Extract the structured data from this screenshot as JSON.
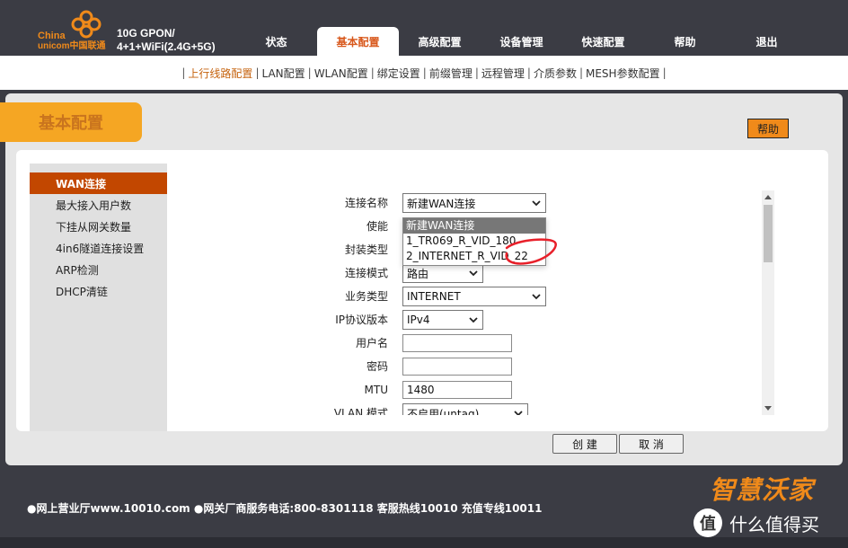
{
  "header": {
    "brand_en1": "China",
    "brand_en2": "unicom中国联通",
    "model_line1": "10G GPON/",
    "model_line2": "4+1+WiFi(2.4G+5G)",
    "nav": [
      "状态",
      "基本配置",
      "高级配置",
      "设备管理",
      "快速配置",
      "帮助",
      "退出"
    ],
    "active_nav": "基本配置"
  },
  "subnav": {
    "items": [
      "上行线路配置",
      "LAN配置",
      "WLAN配置",
      "绑定设置",
      "前缀管理",
      "远程管理",
      "介质参数",
      "MESH参数配置"
    ],
    "active": "上行线路配置"
  },
  "section": {
    "title": "基本配置",
    "help_label": "帮助"
  },
  "leftmenu": {
    "items": [
      "WAN连接",
      "最大接入用户数",
      "下挂从网关数量",
      "4in6隧道连接设置",
      "ARP检测",
      "DHCP清链"
    ],
    "active": "WAN连接"
  },
  "form": {
    "connection_name": {
      "label": "连接名称",
      "value": "新建WAN连接"
    },
    "enable": {
      "label": "使能"
    },
    "encapsulation": {
      "label": "封装类型"
    },
    "connection_mode": {
      "label": "连接模式",
      "value": "路由"
    },
    "service_type": {
      "label": "业务类型",
      "value": "INTERNET"
    },
    "ip_version": {
      "label": "IP协议版本",
      "value": "IPv4"
    },
    "username": {
      "label": "用户名",
      "value": ""
    },
    "password": {
      "label": "密码",
      "value": ""
    },
    "mtu": {
      "label": "MTU",
      "value": "1480"
    },
    "vlan_mode": {
      "label": "VLAN 模式",
      "value": "不启用(untag)"
    }
  },
  "dropdown_options": [
    "新建WAN连接",
    "1_TR069_R_VID_180",
    "2_INTERNET_R_VID_22"
  ],
  "buttons": {
    "create": "创 建",
    "cancel": "取 消"
  },
  "footer": {
    "text": "●网上营业厅www.10010.com ●网关厂商服务电话:800-8301118 客服热线10010 充值专线10011"
  },
  "watermark": {
    "line1": "智慧沃家",
    "logo_char": "值",
    "line2": "什么值得买"
  },
  "colors": {
    "accent_orange": "#f5a623",
    "active_red": "#c24700",
    "header_bg": "#3b3c44",
    "annotation_red": "#e8202a"
  }
}
